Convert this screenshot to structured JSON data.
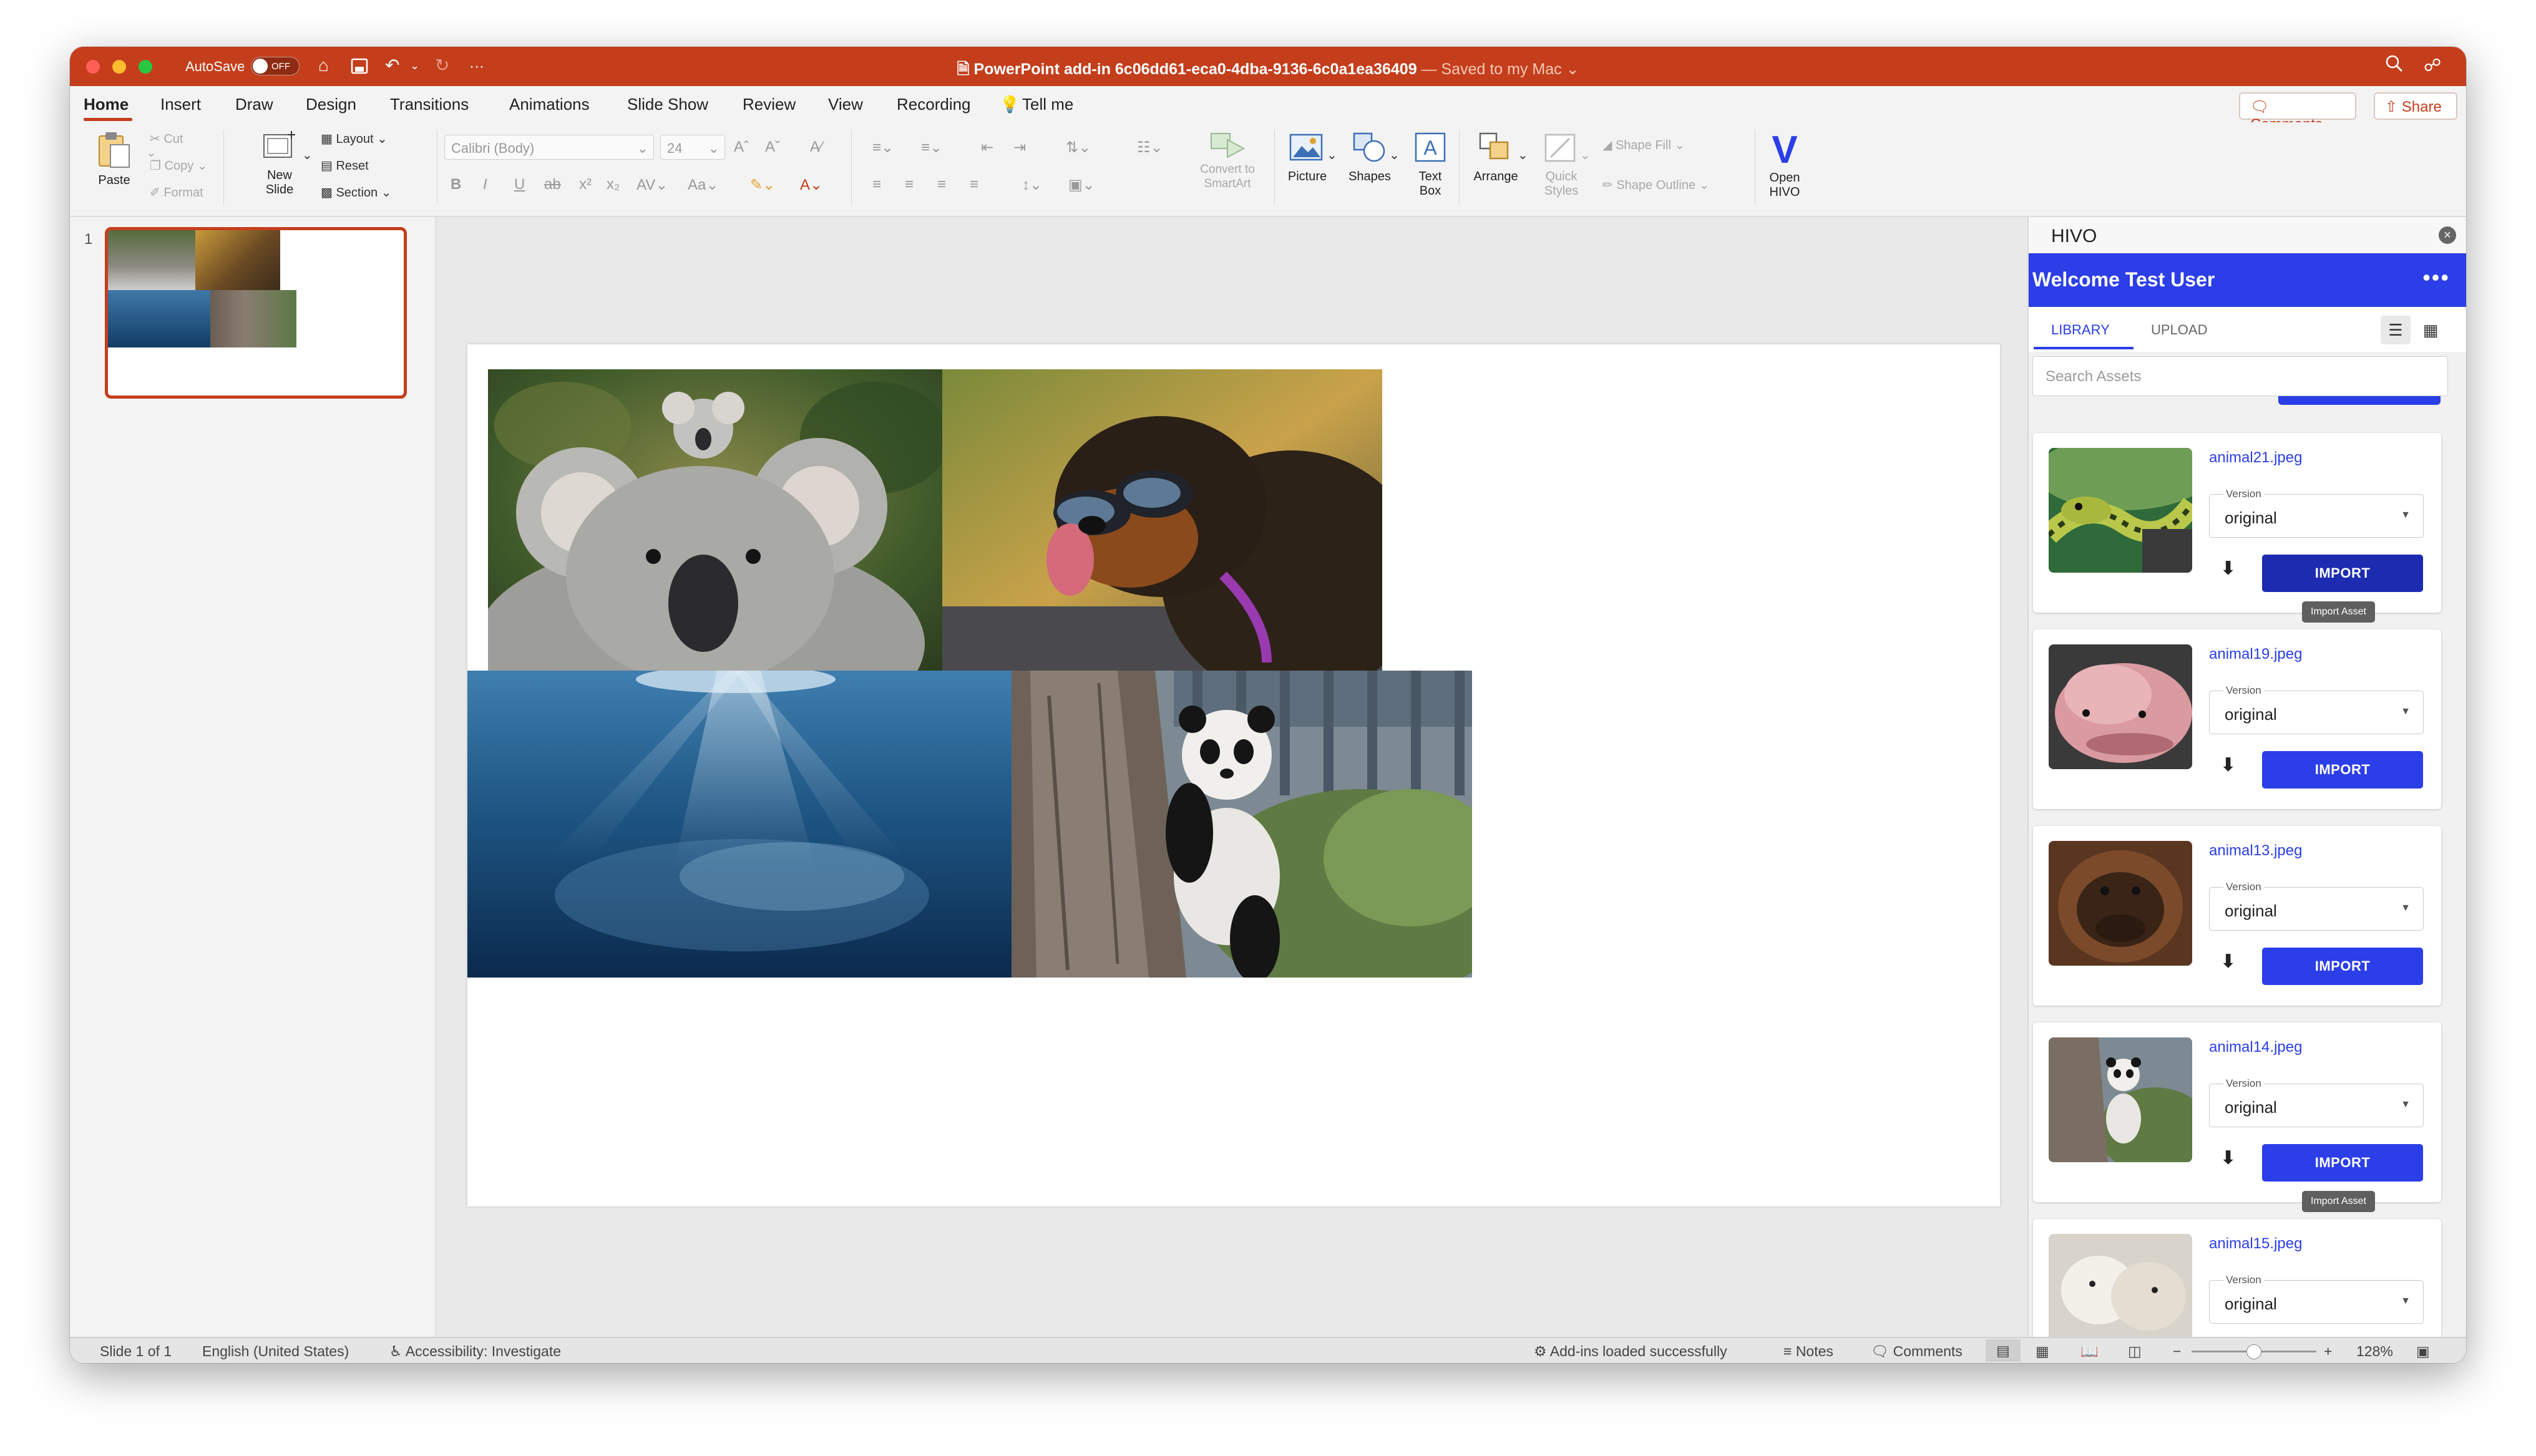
{
  "titlebar": {
    "autosave_label": "AutoSave",
    "autosave_state": "OFF",
    "more": "···",
    "document_title": "PowerPoint add-in 6c06dd61-eca0-4dba-9136-6c0a1ea36409",
    "save_status": "— Saved to my Mac ⌄"
  },
  "tabs": [
    "Home",
    "Insert",
    "Draw",
    "Design",
    "Transitions",
    "Animations",
    "Slide Show",
    "Review",
    "View",
    "Recording",
    "Tell me"
  ],
  "top_buttons": {
    "comments": "Comments",
    "share": "Share"
  },
  "ribbon": {
    "paste": "Paste",
    "cut": "Cut",
    "copy": "Copy",
    "format": "Format",
    "new_slide_1": "New",
    "new_slide_2": "Slide",
    "layout": "Layout",
    "reset": "Reset",
    "section": "Section",
    "font_name": "Calibri (Body)",
    "font_size": "24",
    "convert_1": "Convert to",
    "convert_2": "SmartArt",
    "picture": "Picture",
    "shapes": "Shapes",
    "textbox_1": "Text",
    "textbox_2": "Box",
    "arrange": "Arrange",
    "quick_styles_1": "Quick",
    "quick_styles_2": "Styles",
    "shape_fill": "Shape Fill",
    "shape_outline": "Shape Outline",
    "open_hivo_1": "Open",
    "open_hivo_2": "HIVO",
    "hivo_logo": "V"
  },
  "thumbnails": {
    "number": "1"
  },
  "hivo": {
    "title": "HIVO",
    "close": "×",
    "welcome": "Welcome Test User",
    "more": "•••",
    "tab_library": "LIBRARY",
    "tab_upload": "UPLOAD",
    "search_placeholder": "Search Assets",
    "version_label": "Version",
    "import_label": "IMPORT",
    "tooltip": "Import Asset",
    "download_icon": "⬇",
    "assets": [
      {
        "name": "animal21.jpeg",
        "version": "original"
      },
      {
        "name": "animal19.jpeg",
        "version": "original"
      },
      {
        "name": "animal13.jpeg",
        "version": "original"
      },
      {
        "name": "animal14.jpeg",
        "version": "original"
      },
      {
        "name": "animal15.jpeg",
        "version": "original"
      }
    ]
  },
  "statusbar": {
    "slide": "Slide 1 of 1",
    "language": "English (United States)",
    "accessibility": "Accessibility: Investigate",
    "addins": "Add-ins loaded successfully",
    "notes": "Notes",
    "comments": "Comments",
    "zoom": "128%"
  },
  "colors": {
    "accent": "#c43e1c",
    "hivo_blue": "#2b3ee7"
  }
}
